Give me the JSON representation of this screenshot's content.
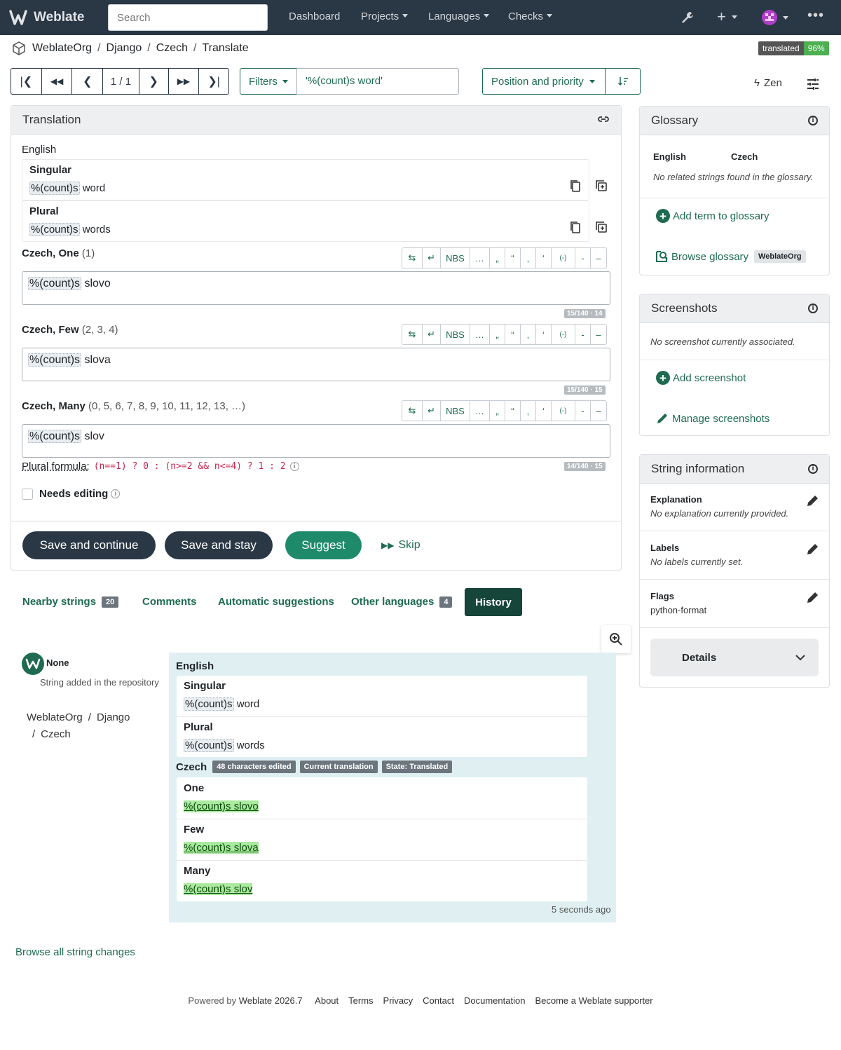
{
  "navbar": {
    "brand": "Weblate",
    "search_placeholder": "Search",
    "items": [
      "Dashboard",
      "Projects",
      "Languages",
      "Checks"
    ]
  },
  "breadcrumb": [
    "WeblateOrg",
    "Django",
    "Czech",
    "Translate"
  ],
  "progress": {
    "label": "translated",
    "percent": "96%"
  },
  "toolbar": {
    "position": "1 / 1",
    "filters": "Filters",
    "query": "'%(count)s word'",
    "sort": "Position and priority",
    "zen": "Zen"
  },
  "translation": {
    "title": "Translation",
    "source_lang": "English",
    "singular_label": "Singular",
    "singular_ph": "%(count)s",
    "singular_text": " word",
    "plural_label": "Plural",
    "plural_ph": "%(count)s",
    "plural_text": " words",
    "forms": [
      {
        "label": "Czech, One",
        "nums": "(1)",
        "ph": "%(count)s",
        "text": " slovo",
        "counter": "15/140 · 14"
      },
      {
        "label": "Czech, Few",
        "nums": "(2, 3, 4)",
        "ph": "%(count)s",
        "text": " slova",
        "counter": "15/140 · 15"
      },
      {
        "label": "Czech, Many",
        "nums": "(0, 5, 6, 7, 8, 9, 10, 11, 12, 13, …)",
        "ph": "%(count)s",
        "text": " slov",
        "counter": "14/140 · 15"
      }
    ],
    "tb_buttons": [
      "⇆",
      "↵",
      "NBS",
      "…",
      "„",
      "“",
      "‚",
      "‘",
      "(-)",
      "-",
      "–"
    ],
    "plural_formula_label": "Plural formula:",
    "plural_formula": "(n==1) ? 0 : (n>=2 && n<=4) ? 1 : 2",
    "needs_editing": "Needs editing",
    "save_continue": "Save and continue",
    "save_stay": "Save and stay",
    "suggest": "Suggest",
    "skip": "Skip"
  },
  "tabs": [
    {
      "label": "Nearby strings",
      "count": "20"
    },
    {
      "label": "Comments"
    },
    {
      "label": "Automatic suggestions"
    },
    {
      "label": "Other languages",
      "count": "4"
    },
    {
      "label": "History"
    }
  ],
  "history": {
    "user": "None",
    "action": "String added in the repository",
    "path1": "WeblateOrg",
    "path2": "Django",
    "path3": "Czech",
    "english": "English",
    "singular": "Singular",
    "plural": "Plural",
    "ph": "%(count)s",
    "sing_text": " word",
    "plur_text": " words",
    "czech": "Czech",
    "badges": [
      "48 characters edited",
      "Current translation",
      "State: Translated"
    ],
    "forms": [
      {
        "label": "One",
        "text": "%(count)s slovo"
      },
      {
        "label": "Few",
        "text": "%(count)s slova"
      },
      {
        "label": "Many",
        "text": "%(count)s slov"
      }
    ],
    "time": "5 seconds ago",
    "browse_all": "Browse all string changes"
  },
  "glossary": {
    "title": "Glossary",
    "col1": "English",
    "col2": "Czech",
    "empty": "No related strings found in the glossary.",
    "add": "Add term to glossary",
    "browse": "Browse glossary",
    "project": "WeblateOrg"
  },
  "screenshots": {
    "title": "Screenshots",
    "empty": "No screenshot currently associated.",
    "add": "Add screenshot",
    "manage": "Manage screenshots"
  },
  "info": {
    "title": "String information",
    "explanation_label": "Explanation",
    "explanation": "No explanation currently provided.",
    "labels_label": "Labels",
    "labels": "No labels currently set.",
    "flags_label": "Flags",
    "flags": "python-format",
    "details": "Details"
  },
  "footer": {
    "powered": "Powered by",
    "version": "Weblate 2026.7",
    "links": [
      "About",
      "Terms",
      "Privacy",
      "Contact",
      "Documentation",
      "Become a Weblate supporter"
    ]
  },
  "colors": {
    "navbar": "#2a3744",
    "accent": "#1e6b52",
    "dark_button": "#2a3744",
    "suggest": "#1e8a6a",
    "progress": "#4caf50"
  }
}
